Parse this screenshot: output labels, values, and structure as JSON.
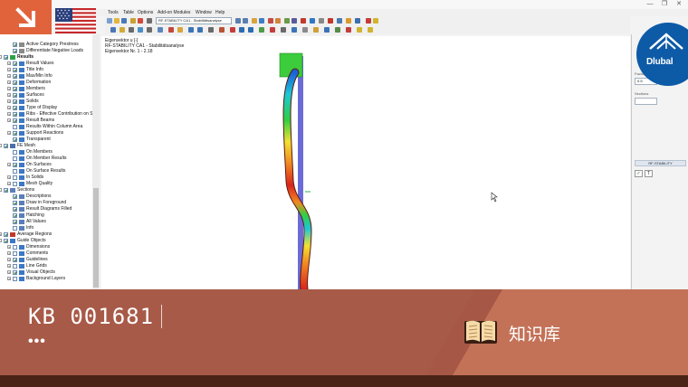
{
  "window": {
    "minimize": "—",
    "restore": "❐",
    "close": "✕"
  },
  "menu": [
    "Tools",
    "Table",
    "Options",
    "Add-on Modules",
    "Window",
    "Help"
  ],
  "toolbar": {
    "case_selector": "RF-STABILITY CA1 - Stabilitätsanalyse"
  },
  "navigator": {
    "items": [
      {
        "label": "Active Category Prestress",
        "indent": 1,
        "checked": true,
        "icon": "gear-icon"
      },
      {
        "label": "Differentiate Negative Loads",
        "indent": 1,
        "checked": true,
        "icon": "gear-icon"
      },
      {
        "label": "Results",
        "indent": 0,
        "checked": true,
        "icon": "results-icon",
        "bold": true,
        "expander": "-"
      },
      {
        "label": "Result Values",
        "indent": 1,
        "checked": true,
        "icon": "folder-icon",
        "expander": "+"
      },
      {
        "label": "Title Info",
        "indent": 1,
        "checked": true,
        "icon": "folder-icon",
        "expander": "+"
      },
      {
        "label": "Max/Min Info",
        "indent": 1,
        "checked": true,
        "icon": "folder-icon",
        "expander": "+"
      },
      {
        "label": "Deformation",
        "indent": 1,
        "checked": true,
        "icon": "folder-icon",
        "expander": "+"
      },
      {
        "label": "Members",
        "indent": 1,
        "checked": true,
        "icon": "folder-icon",
        "expander": "+"
      },
      {
        "label": "Surfaces",
        "indent": 1,
        "checked": true,
        "icon": "folder-icon",
        "expander": "+"
      },
      {
        "label": "Solids",
        "indent": 1,
        "checked": true,
        "icon": "folder-icon",
        "expander": "+"
      },
      {
        "label": "Type of Display",
        "indent": 1,
        "checked": true,
        "icon": "folder-icon",
        "expander": "+"
      },
      {
        "label": "Ribs - Effective Contribution on S",
        "indent": 1,
        "checked": true,
        "icon": "folder-icon",
        "expander": "+"
      },
      {
        "label": "Result Beams",
        "indent": 1,
        "checked": true,
        "icon": "folder-icon",
        "expander": "+"
      },
      {
        "label": "Results Within Column Area",
        "indent": 1,
        "checked": false,
        "icon": "folder-icon"
      },
      {
        "label": "Support Reactions",
        "indent": 1,
        "checked": true,
        "icon": "folder-icon",
        "expander": "+"
      },
      {
        "label": "Transparent",
        "indent": 1,
        "checked": true,
        "icon": "folder-icon"
      },
      {
        "label": "FE Mesh",
        "indent": 0,
        "checked": true,
        "icon": "mesh-icon",
        "expander": "-"
      },
      {
        "label": "On Members",
        "indent": 1,
        "checked": false,
        "icon": "folder-icon"
      },
      {
        "label": "On Member Results",
        "indent": 1,
        "checked": false,
        "icon": "folder-icon"
      },
      {
        "label": "On Surfaces",
        "indent": 1,
        "checked": true,
        "icon": "folder-icon",
        "expander": "+"
      },
      {
        "label": "On Surface Results",
        "indent": 1,
        "checked": false,
        "icon": "folder-icon"
      },
      {
        "label": "In Solids",
        "indent": 1,
        "checked": false,
        "icon": "folder-icon",
        "expander": "+"
      },
      {
        "label": "Mesh Quality",
        "indent": 1,
        "checked": false,
        "icon": "folder-icon",
        "expander": "+"
      },
      {
        "label": "Sections",
        "indent": 0,
        "checked": true,
        "icon": "sections-icon",
        "expander": "-"
      },
      {
        "label": "Descriptions",
        "indent": 1,
        "checked": true,
        "icon": "sections-icon"
      },
      {
        "label": "Draw in Foreground",
        "indent": 1,
        "checked": true,
        "icon": "sections-icon"
      },
      {
        "label": "Result Diagrams Filled",
        "indent": 1,
        "checked": true,
        "icon": "sections-icon"
      },
      {
        "label": "Hatching",
        "indent": 1,
        "checked": true,
        "icon": "sections-icon"
      },
      {
        "label": "All Values",
        "indent": 1,
        "checked": true,
        "icon": "sections-icon"
      },
      {
        "label": "Info",
        "indent": 1,
        "checked": false,
        "icon": "sections-icon"
      },
      {
        "label": "Average Regions",
        "indent": 0,
        "checked": true,
        "icon": "regions-icon",
        "expander": "+"
      },
      {
        "label": "Guide Objects",
        "indent": 0,
        "checked": true,
        "icon": "guide-icon",
        "expander": "-"
      },
      {
        "label": "Dimensions",
        "indent": 1,
        "checked": false,
        "icon": "guide-icon",
        "expander": "+"
      },
      {
        "label": "Comments",
        "indent": 1,
        "checked": false,
        "icon": "guide-icon",
        "expander": "+"
      },
      {
        "label": "Guidelines",
        "indent": 1,
        "checked": true,
        "icon": "guide-icon",
        "expander": "+"
      },
      {
        "label": "Line Grids",
        "indent": 1,
        "checked": false,
        "icon": "guide-icon",
        "expander": "+"
      },
      {
        "label": "Visual Objects",
        "indent": 1,
        "checked": true,
        "icon": "guide-icon",
        "expander": "+"
      },
      {
        "label": "Background Layers",
        "indent": 1,
        "checked": false,
        "icon": "guide-icon",
        "expander": "+"
      }
    ]
  },
  "viewport": {
    "info_lines": [
      "Eigenvektor u [-]",
      "RF-STABILITY CA1 - Stabilitätsanalyse",
      "Eigenvektor Nr. 1 - 2.18"
    ]
  },
  "panel": {
    "factor_label": "Factor",
    "factor_value": "0.5",
    "sections_label": "Sections",
    "sections_value": "",
    "header": "RF-STABILITY",
    "btn_check": "✓",
    "btn_filter": "T"
  },
  "logo": {
    "text": "Dlubal"
  },
  "colors": {
    "banner_light": "#c37258",
    "banner_mid": "#a65746",
    "banner_dark": "#4a2417",
    "orange_tile": "#e1633c",
    "logo_blue": "#0d5aa7",
    "accent_red": "#c0392b"
  },
  "banner": {
    "kb_id": "KB 001681",
    "dots": "•••",
    "label": "知识库"
  }
}
